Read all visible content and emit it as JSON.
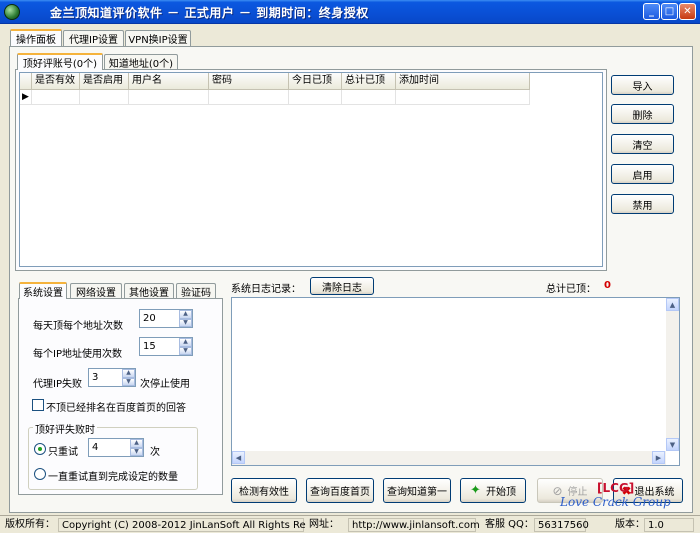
{
  "window": {
    "title": "金兰顶知道评价软件 － 正式用户 － 到期时间：终身授权",
    "minimize_glyph": "_",
    "maximize_glyph": "□",
    "close_glyph": "✕"
  },
  "top_tabs": [
    "操作面板",
    "代理IP设置",
    "VPN换IP设置"
  ],
  "inner_tabs": [
    "顶好评账号(0个)",
    "知道地址(0个)"
  ],
  "grid": {
    "columns": [
      "是否有效",
      "是否启用",
      "用户名",
      "密码",
      "今日已顶",
      "总计已顶",
      "添加时间"
    ],
    "row_pointer": "▶"
  },
  "side_buttons": [
    "导入",
    "删除",
    "清空",
    "启用",
    "禁用"
  ],
  "settings_tabs": [
    "系统设置",
    "网络设置",
    "其他设置",
    "验证码"
  ],
  "settings": {
    "per_day_label": "每天顶每个地址次数",
    "per_day_value": "20",
    "per_ip_label": "每个IP地址使用次数",
    "per_ip_value": "15",
    "proxy_fail_label": "代理IP失败",
    "proxy_fail_value": "3",
    "proxy_fail_suffix": "次停止使用",
    "skip_checkbox_label": "不顶已经排名在百度首页的回答",
    "retry_group_label": "顶好评失败时",
    "retry_only_label": "只重试",
    "retry_only_value": "4",
    "retry_only_suffix": "次",
    "retry_until_label": "一直重试直到完成设定的数量"
  },
  "log": {
    "label": "系统日志记录：",
    "clear_button": "清除日志",
    "total_label": "总计已顶：",
    "total_value": "0"
  },
  "bottom_buttons": {
    "check": "检测有效性",
    "baidu": "查询百度首页",
    "first": "查询知道第一",
    "start": "开始顶",
    "stop": "停止",
    "exit": "退出系统"
  },
  "status": {
    "copyright_label": "版权所有：",
    "copyright_text": "Copyright (C) 2008-2012 JinLanSoft All Rights Reserved.",
    "url_label": "网址：",
    "url_text": "http://www.jinlansoft.com",
    "qq_label": "客服 QQ：",
    "qq_text": "56317560",
    "version_label": "版本：",
    "version_text": "1.0"
  },
  "watermark": {
    "lcg": "[LCG]",
    "group": "Love Crack Group"
  },
  "colors": {
    "title_bar": "#0a4fd5",
    "accent_red": "#d40000",
    "start_green": "#1a9a1a"
  }
}
